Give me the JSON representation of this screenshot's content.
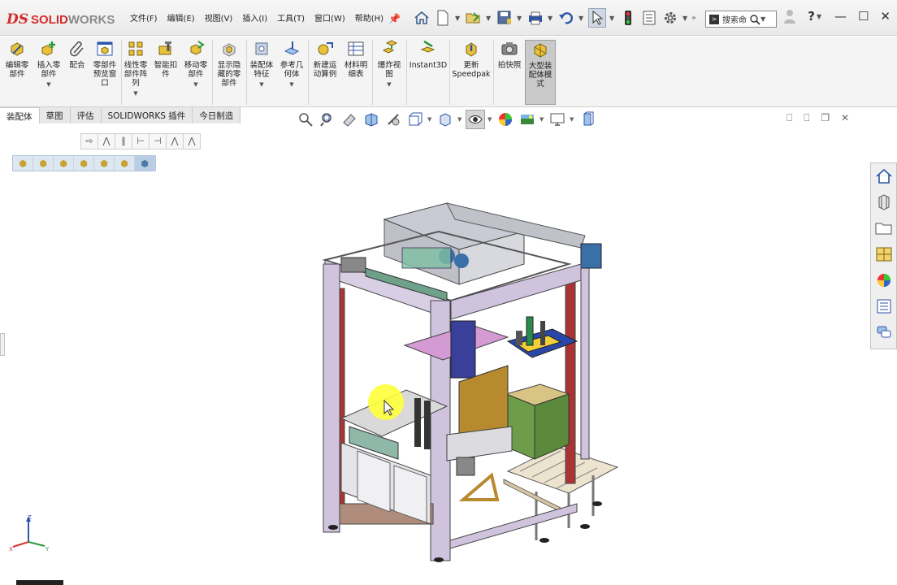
{
  "app": {
    "brand_prefix": "SOLID",
    "brand_suffix": "WORKS"
  },
  "menu": [
    "文件(F)",
    "编辑(E)",
    "视图(V)",
    "插入(I)",
    "工具(T)",
    "窗口(W)",
    "帮助(H)"
  ],
  "search": {
    "placeholder": "搜索命"
  },
  "ribbon": {
    "edit_component": "编辑零\n部件",
    "insert_component": "插入零\n部件",
    "mate": "配合",
    "component_preview": "零部件\n预览窗\n口",
    "linear_pattern": "线性零\n部件阵\n列",
    "smart_fasteners": "智能扣\n件",
    "move_component": "移动零\n部件",
    "show_hidden": "显示隐\n藏的零\n部件",
    "assembly_features": "装配体\n特征",
    "reference_geometry": "参考几\n何体",
    "new_motion_study": "新建运\n动算例",
    "bom": "材料明\n细表",
    "exploded_view": "爆炸视\n图",
    "instant3d": "Instant3D",
    "update_speedpak": "更新\nSpeedpak",
    "snapshot": "拍快照",
    "large_assembly_mode": "大型装\n配体模\n式"
  },
  "tabs": [
    "装配体",
    "草图",
    "评估",
    "SOLIDWORKS 插件",
    "今日制造"
  ],
  "active_tab": 0,
  "colors": {
    "brand_red": "#d52b2b",
    "frame": "#c6b7d4",
    "highlight_yellow": "#ffff3a"
  },
  "icons": {
    "home": "home-icon",
    "new": "new-document-icon",
    "open": "open-folder-icon",
    "save": "save-icon",
    "print": "print-icon",
    "undo": "undo-icon",
    "select": "select-arrow-icon",
    "traffic": "rebuild-traffic-light-icon",
    "file_props": "file-properties-icon",
    "options": "gear-icon",
    "help": "help-icon"
  }
}
